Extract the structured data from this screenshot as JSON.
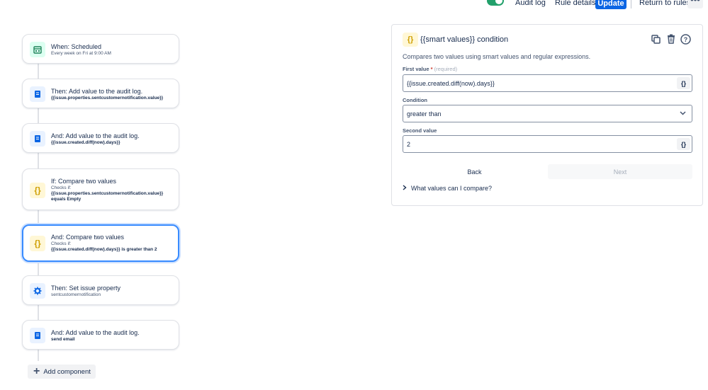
{
  "topbar": {
    "audit_log": "Audit log",
    "rule_details": "Rule details",
    "update": "Update",
    "return_to_rules": "Return to rules",
    "more": "•••"
  },
  "flow": {
    "items": [
      {
        "title": "When: Scheduled",
        "sub": "Every week on Fri at 9:00 AM",
        "icon": "calendar-icon"
      },
      {
        "title": "Then: Add value to the audit log.",
        "sub": "{{issue.properties.sentcustomernotification.value}}",
        "icon": "document-icon"
      },
      {
        "title": "And: Add value to the audit log.",
        "sub": "{{issue.created.diff(now).days}}",
        "icon": "document-icon"
      },
      {
        "title": "If: Compare two values",
        "sub_checks": "Checks if:",
        "sub": "{{issue.properties.sentcustomernotification.value}}",
        "sub2": "equals Empty",
        "icon": "braces-icon"
      },
      {
        "title": "And: Compare two values",
        "sub_checks": "Checks if:",
        "sub": "{{issue.created.diff(now).days}} is greater than 2",
        "icon": "braces-icon"
      },
      {
        "title": "Then: Set issue property",
        "sub": "sentcustomernotification",
        "icon": "gear-icon"
      },
      {
        "title": "And: Add value to the audit log.",
        "sub": "send email",
        "icon": "document-icon"
      }
    ],
    "add_component": "Add component"
  },
  "panel": {
    "icon_glyph": "{}",
    "title": "{{smart values}} condition",
    "description": "Compares two values using smart values and regular expressions.",
    "first_value_label": "First value",
    "required_mark": "*",
    "required_hint": "(required)",
    "first_value": "{{issue.created.diff(now).days}}",
    "condition_label": "Condition",
    "condition_value": "greater than",
    "second_value_label": "Second value",
    "second_value": "2",
    "smart_value_button": "{}",
    "back": "Back",
    "next": "Next",
    "expander": "What values can I compare?"
  },
  "colors": {
    "accent": "#0c66e4",
    "toggle_on": "#22a06b",
    "selected_border": "#388bff"
  }
}
